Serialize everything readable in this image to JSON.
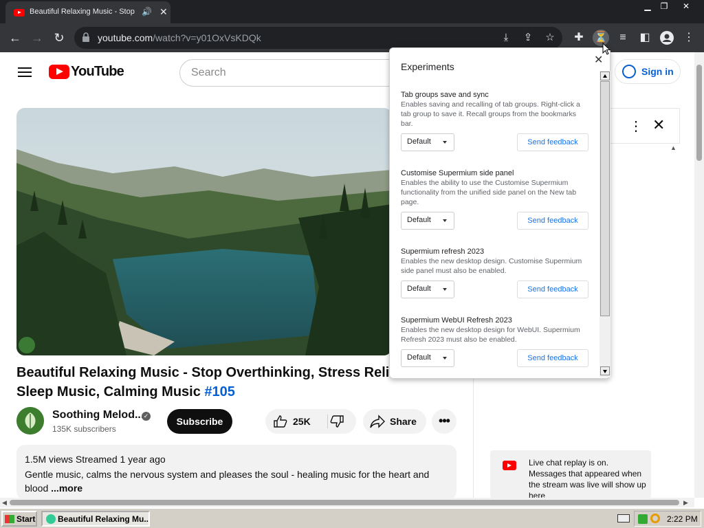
{
  "browser": {
    "tab_title": "Beautiful Relaxing Music - Stop",
    "url_host": "youtube.com",
    "url_path": "/watch?v=y01OxVsKDQk",
    "window_controls": [
      "minimize-icon",
      "restore-icon",
      "close-icon"
    ]
  },
  "youtube": {
    "logo_text": "YouTube",
    "search_placeholder": "Search",
    "signin_label": "Sign in",
    "video_title": "Beautiful Relaxing Music - Stop Overthinking, Stress Relief M",
    "video_title_line2": "Sleep Music, Calming Music ",
    "video_hashtag": "#105",
    "channel_name": "Soothing Melod...",
    "subscribers": "135K subscribers",
    "subscribe_label": "Subscribe",
    "like_count": "25K",
    "share_label": "Share",
    "more_actions": "•••",
    "desc_stats": "1.5M views  Streamed 1 year ago",
    "desc_text": "Gentle music, calms the nervous system and pleases the soul - healing music for the heart and blood ",
    "desc_more": "...more",
    "chat_notice": "Live chat replay is on. Messages that appeared when the stream was live will show up here"
  },
  "experiments": {
    "title": "Experiments",
    "close": "✕",
    "flags": [
      {
        "name": "Tab groups save and sync",
        "description": "Enables saving and recalling of tab groups. Right-click a tab group to save it. Recall groups from the bookmarks bar.",
        "value": "Default",
        "feedback": "Send feedback"
      },
      {
        "name": "Customise Supermium side panel",
        "description": "Enables the ability to use the Customise Supermium functionality from the unified side panel on the New tab page.",
        "value": "Default",
        "feedback": "Send feedback"
      },
      {
        "name": "Supermium refresh 2023",
        "description": "Enables the new desktop design. Customise Supermium side panel must also be enabled.",
        "value": "Default",
        "feedback": "Send feedback"
      },
      {
        "name": "Supermium WebUI Refresh 2023",
        "description": "Enables the new desktop design for WebUI. Supermium Refresh 2023 must also be enabled.",
        "value": "Default",
        "feedback": "Send feedback"
      }
    ]
  },
  "taskbar": {
    "start_label": "Start",
    "task_label": "Beautiful Relaxing Mu...",
    "clock": "2:22 PM"
  }
}
